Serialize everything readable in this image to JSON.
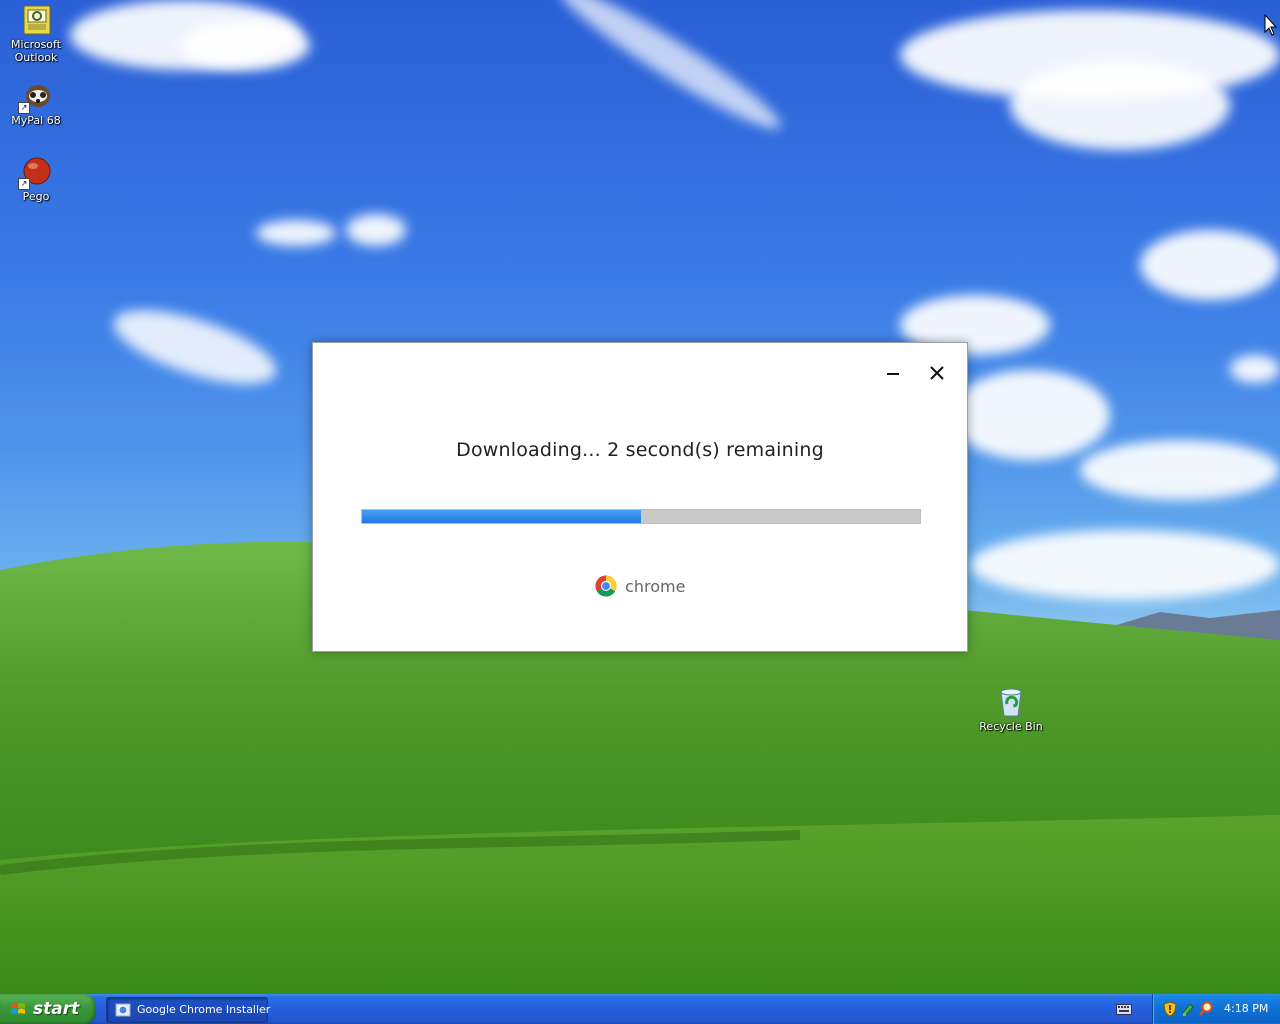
{
  "desktop": {
    "icons": [
      {
        "label_line1": "Microsoft",
        "label_line2": "Outlook",
        "icon": "outlook-icon"
      },
      {
        "label_line1": "MyPal 68",
        "icon": "mypal-icon"
      },
      {
        "label_line1": "Pego",
        "icon": "pego-icon"
      },
      {
        "label_line1": "Recycle Bin",
        "icon": "recycle-bin-icon"
      }
    ]
  },
  "installer": {
    "status": "Downloading... 2 second(s) remaining",
    "progress_fraction": 0.5,
    "brand_name": "chrome",
    "minimize_icon": "minimize-icon",
    "close_icon": "close-icon"
  },
  "taskbar": {
    "start_label": "start",
    "task_item_label": "Google Chrome Installer",
    "clock": "4:18 PM"
  },
  "colors": {
    "progress_fill": "#2b86ea",
    "progress_track": "#c9c9c9",
    "taskbar": "#245edb",
    "start_button": "#3c9a3c"
  }
}
